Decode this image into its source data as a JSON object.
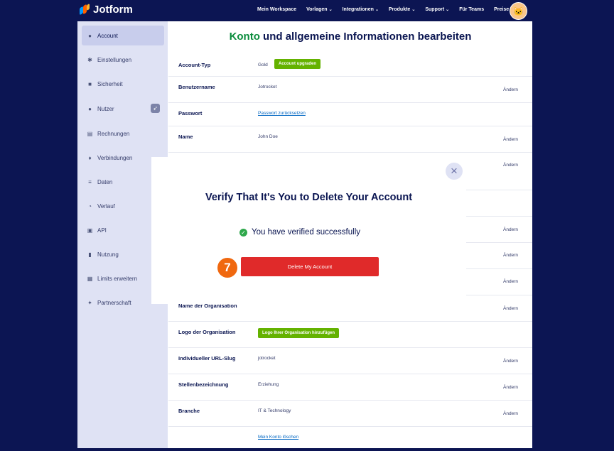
{
  "brand": {
    "name": "Jotform"
  },
  "nav": [
    {
      "label": "Mein Workspace",
      "chevron": false
    },
    {
      "label": "Vorlagen",
      "chevron": true
    },
    {
      "label": "Integrationen",
      "chevron": true
    },
    {
      "label": "Produkte",
      "chevron": true
    },
    {
      "label": "Support",
      "chevron": true
    },
    {
      "label": "Für Teams",
      "chevron": false
    },
    {
      "label": "Preise",
      "chevron": false
    }
  ],
  "chevron_glyph": "⌄",
  "sidebar": {
    "items": [
      {
        "label": "Account",
        "icon": "user-icon",
        "glyph": "●"
      },
      {
        "label": "Einstellungen",
        "icon": "gear-icon",
        "glyph": "✱"
      },
      {
        "label": "Sicherheit",
        "icon": "lock-icon",
        "glyph": "■"
      },
      {
        "label": "Nutzer",
        "icon": "users-icon",
        "glyph": "●"
      },
      {
        "label": "Rechnungen",
        "icon": "invoice-icon",
        "glyph": "▤"
      },
      {
        "label": "Verbindungen",
        "icon": "plug-icon",
        "glyph": "♦"
      },
      {
        "label": "Daten",
        "icon": "database-icon",
        "glyph": "≡"
      },
      {
        "label": "Verlauf",
        "icon": "history-icon",
        "glyph": "◔"
      },
      {
        "label": "API",
        "icon": "api-icon",
        "glyph": "▣"
      },
      {
        "label": "Nutzung",
        "icon": "bar-chart-icon",
        "glyph": "▮"
      },
      {
        "label": "Limits erweitern",
        "icon": "gift-icon",
        "glyph": "▦"
      },
      {
        "label": "Partnerschaft",
        "icon": "handshake-icon",
        "glyph": "✦"
      }
    ],
    "nutzer_badge_glyph": "➶"
  },
  "heading": {
    "highlight": "Konto",
    "rest": " und allgemeine Informationen bearbeiten"
  },
  "rows": {
    "account_type": {
      "label": "Account-Typ",
      "value": "Gold",
      "button": "Account upgraden"
    },
    "username": {
      "label": "Benutzername",
      "value": "Jotrocket",
      "edit": "Ändern"
    },
    "password": {
      "label": "Passwort",
      "link": "Passwort zurücksetzen"
    },
    "name": {
      "label": "Name",
      "value": "John Doe",
      "edit": "Ändern"
    },
    "row5": {
      "edit": "Ändern"
    },
    "row7": {
      "edit": "Ändern"
    },
    "row8": {
      "edit": "Ändern"
    },
    "row9": {
      "edit": "Ändern"
    },
    "org_name": {
      "label": "Name der Organisation",
      "edit": "Ändern"
    },
    "org_logo": {
      "label": "Logo der Organisation",
      "button": "Logo Ihrer Organisation hinzufügen"
    },
    "url_slug": {
      "label": "Individueller URL-Slug",
      "value": "jotrocket",
      "edit": "Ändern"
    },
    "job_title": {
      "label": "Stellenbezeichnung",
      "value": "Erziehung",
      "edit": "Ändern"
    },
    "industry": {
      "label": "Branche",
      "value": "IT & Technology",
      "edit": "Ändern"
    },
    "delete": {
      "link": "Mein Konto löschen"
    }
  },
  "modal": {
    "title": "Verify That It's You to Delete Your Account",
    "verified_text": "You have verified successfully",
    "delete_button": "Delete My Account",
    "close_glyph": "×",
    "check_glyph": "✓"
  },
  "step_badge": "7",
  "avatar_glyph": "🐱"
}
